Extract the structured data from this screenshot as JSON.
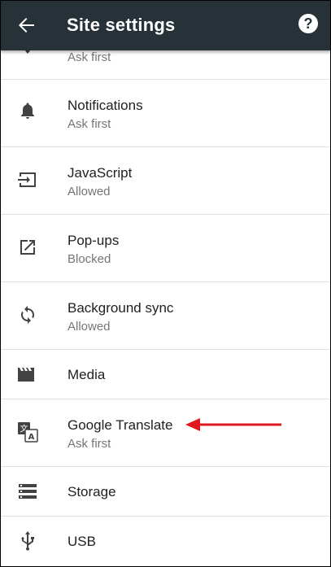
{
  "appbar": {
    "title": "Site settings",
    "back_icon": "arrow-back-icon",
    "help_icon": "help-icon",
    "help_glyph": "?"
  },
  "rows": [
    {
      "label": "",
      "sub": "Ask first",
      "icon": "location-icon"
    },
    {
      "label": "Notifications",
      "sub": "Ask first",
      "icon": "bell-icon"
    },
    {
      "label": "JavaScript",
      "sub": "Allowed",
      "icon": "javascript-icon"
    },
    {
      "label": "Pop-ups",
      "sub": "Blocked",
      "icon": "popup-icon"
    },
    {
      "label": "Background sync",
      "sub": "Allowed",
      "icon": "sync-icon"
    },
    {
      "label": "Media",
      "sub": "",
      "icon": "media-icon"
    },
    {
      "label": "Google Translate",
      "sub": "Ask first",
      "icon": "translate-icon"
    },
    {
      "label": "Storage",
      "sub": "",
      "icon": "storage-icon"
    },
    {
      "label": "USB",
      "sub": "",
      "icon": "usb-icon"
    }
  ],
  "annotation": {
    "icon": "red-arrow-icon",
    "color": "#e0191e"
  },
  "colors": {
    "appbar": "#263238",
    "divider": "#e0e0e0",
    "subtext": "#757575"
  }
}
